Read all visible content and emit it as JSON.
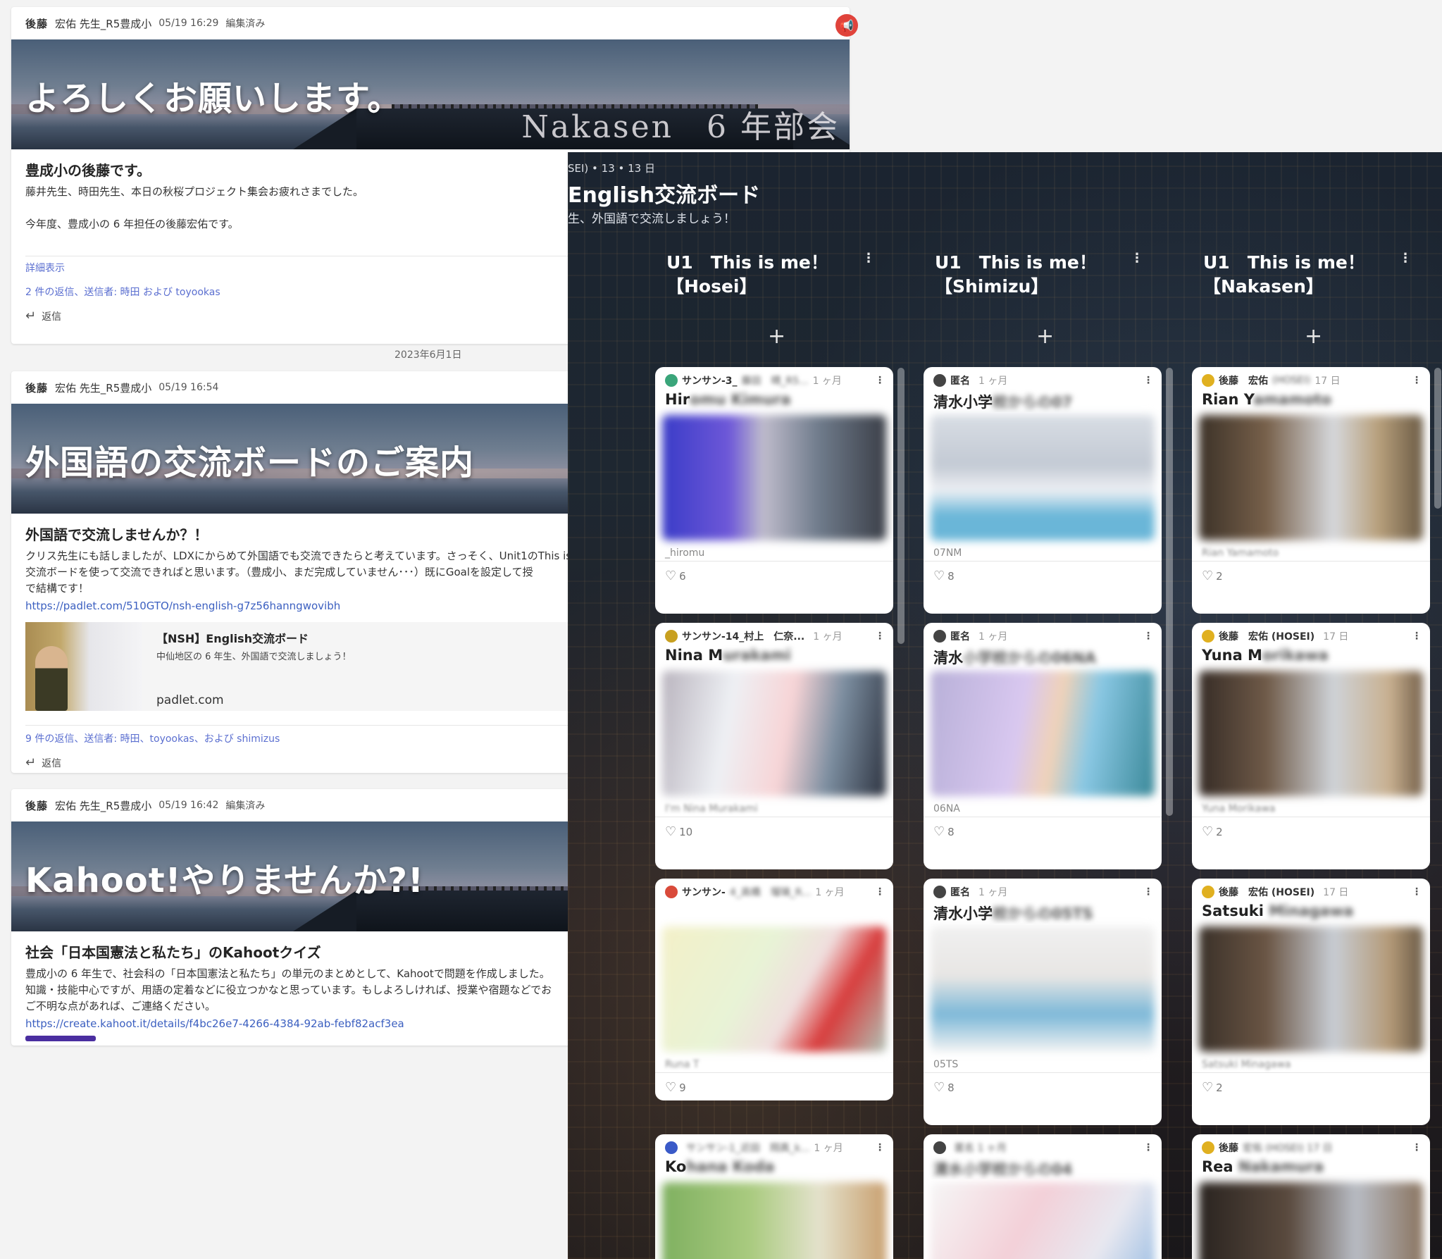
{
  "posts": [
    {
      "author": "後藤",
      "name_line": "宏佑 先生_R5豊成小",
      "time": "05/19 16:29",
      "edited": "編集済み",
      "banner_title": "よろしくお願いします。",
      "banner_sub": "Nakasen　6 年部会",
      "subject": "豊成小の後藤です。",
      "lines": [
        "藤井先生、時田先生、本日の秋桜プロジェクト集会お疲れさまでした。",
        "",
        "今年度、豊成小の 6 年担任の後藤宏佑です。"
      ],
      "more": "詳細表示",
      "replies": "2 件の返信、送信者: 時田 および toyookas",
      "reply": "返信"
    },
    {
      "author": "後藤",
      "name_line": "宏佑 先生_R5豊成小",
      "time": "05/19 16:54",
      "banner_title": "外国語の交流ボードのご案内",
      "subject": "外国語で交流しませんか？！",
      "lines": [
        "クリス先生にも話しましたが、LDXにからめて外国語でも交流できたらと考えています。さっそく、Unit1のThis is",
        "交流ボードを使って交流できればと思います。（豊成小、まだ完成していません･･･）既にGoalを設定して授",
        "で結構です！"
      ],
      "url": "https://padlet.com/510GTO/nsh-english-g7z56hanngwovibh",
      "preview_title": "【NSH】English交流ボード",
      "preview_desc": "中仙地区の 6 年生、外国語で交流しましょう！",
      "preview_domain": "padlet.com",
      "replies": "9 件の返信、送信者: 時田、toyookas、および shimizus",
      "reply": "返信"
    },
    {
      "author": "後藤",
      "name_line": "宏佑 先生_R5豊成小",
      "time": "05/19 16:42",
      "edited": "編集済み",
      "banner_title": "Kahoot!やりませんか?!",
      "banner_sub": "N",
      "subject": "社会「日本国憲法と私たち」のKahootクイズ",
      "lines": [
        "豊成小の 6 年生で、社会科の「日本国憲法と私たち」の単元のまとめとして、Kahootで問題を作成しました。",
        "知識・技能中心ですが、用語の定着などに役立つかなと思っています。もしよろしければ、授業や宿題などでお",
        "ご不明な点があれば、ご連絡ください。"
      ],
      "url": "https://create.kahoot.it/details/f4bc26e7-4266-4384-92ab-febf82acf3ea"
    }
  ],
  "date_separator": "2023年6月1日",
  "padlet": {
    "crumb": "SEI)  • 13  • 13 日",
    "title": "English交流ボード",
    "description": "生、外国語で交流しましょう！",
    "columns": [
      {
        "title_line1": "U1　This is me！",
        "title_line2": "【Hosei】",
        "cards": [
          {
            "author": "サンサン-3_",
            "author_blur": "藤田　晴_R5...",
            "time": "1 ヶ月",
            "title": "Hir",
            "title_blur": "omu Kimura",
            "caption": "_hiromu",
            "likes": "6",
            "avatar": "#3aa57a"
          },
          {
            "author": "サンサン-14_村上　仁奈...",
            "time": "1 ヶ月",
            "title": "Nina M",
            "title_blur": "urakami",
            "caption": "",
            "caption_blur": "I'm Nina Murakami",
            "likes": "10",
            "avatar": "#c8a020"
          },
          {
            "author": "サンサン-",
            "author_blur": "4_高橋　瑠璃_R...",
            "time": "1 ヶ月",
            "title": "",
            "caption": "",
            "caption_blur": "Runa T",
            "likes": "9",
            "avatar": "#d94a3a"
          },
          {
            "author": "",
            "author_blur": "サンサン-1_近田　翔真_k...",
            "time": "1 ヶ月",
            "title": "Ko",
            "title_blur": "hana Koda",
            "caption": "",
            "likes": "",
            "avatar": "#3a5ac8"
          }
        ]
      },
      {
        "title_line1": "U1　This is me！",
        "title_line2": "【Shimizu】",
        "cards": [
          {
            "author": "匿名",
            "time": "1 ヶ月",
            "title": "清水小学",
            "title_blur": "校からの07",
            "caption": "07NM",
            "likes": "8",
            "avatar": "#444"
          },
          {
            "author": "匿名",
            "time": "1 ヶ月",
            "title": "清水",
            "title_blur": "小学校からの06NA",
            "caption": "06NA",
            "likes": "8",
            "avatar": "#444"
          },
          {
            "author": "匿名",
            "time": "1 ヶ月",
            "title": "清水小学",
            "title_blur": "校からの05TS",
            "caption": "05TS",
            "likes": "8",
            "avatar": "#444"
          },
          {
            "author": "",
            "author_blur": "匿名 1 ヶ月",
            "time": "",
            "title": "",
            "title_blur": "清水小学校からの04",
            "caption": "",
            "likes": "",
            "avatar": "#444"
          }
        ]
      },
      {
        "title_line1": "U1　This is me！",
        "title_line2": "【Nakasen】",
        "cards": [
          {
            "author": "後藤　宏佑",
            "author_blur": "(HOSEI)",
            "time": "17 日",
            "title": "Rian Y",
            "title_blur": "amamoto",
            "caption": "",
            "caption_blur": "Rian Yamamoto",
            "likes": "2",
            "avatar": "#e0b020"
          },
          {
            "author": "後藤　宏佑 (HOSEI)",
            "time": "17 日",
            "title": "Yuna M",
            "title_blur": "orikawa",
            "caption": "",
            "caption_blur": "Yuna Morikawa",
            "likes": "2",
            "avatar": "#e0b020"
          },
          {
            "author": "後藤　宏佑 (HOSEI)",
            "time": "17 日",
            "title": "Satsuki",
            "title_blur": " Minagawa",
            "caption": "",
            "caption_blur": "Satsuki Minagawa",
            "likes": "2",
            "avatar": "#e0b020"
          },
          {
            "author": "後藤",
            "author_blur": "宏佑 (HOSEI) 17 日",
            "time": "",
            "title": "Rea",
            "title_blur": " Nakamura",
            "caption": "",
            "likes": "",
            "avatar": "#e0b020"
          }
        ]
      }
    ]
  }
}
